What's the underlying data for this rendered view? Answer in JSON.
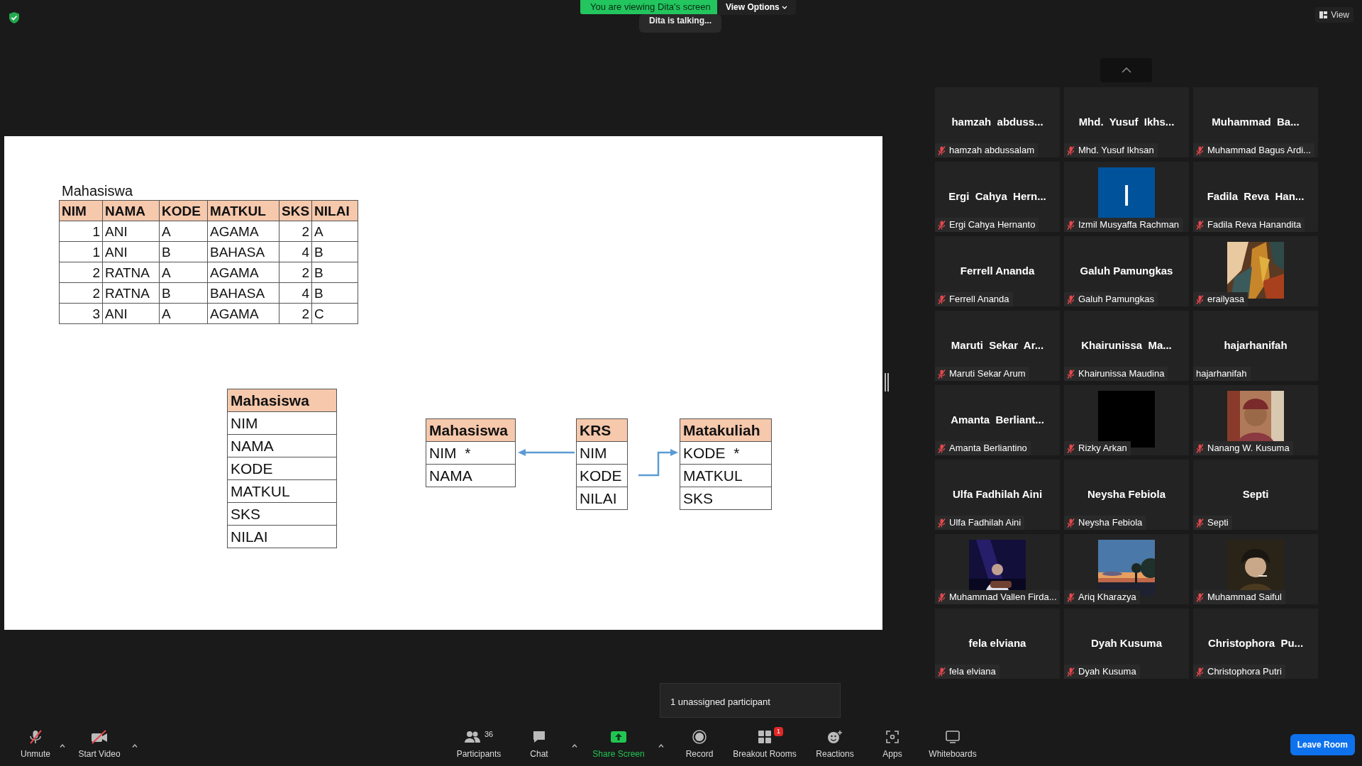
{
  "top_bar": {
    "banner": "You are viewing Dita's screen",
    "view_options": "View Options",
    "talking": "Dita is talking...",
    "view": "View"
  },
  "slide": {
    "caption": "Mahasiswa",
    "table": {
      "columns": [
        "NIM",
        "NAMA",
        "KODE",
        "MATKUL",
        "SKS",
        "NILAI"
      ],
      "rows": [
        [
          "1",
          "ANI",
          "A",
          "AGAMA",
          "2",
          "A"
        ],
        [
          "1",
          "ANI",
          "B",
          "BAHASA",
          "4",
          "B"
        ],
        [
          "2",
          "RATNA",
          "A",
          "AGAMA",
          "2",
          "B"
        ],
        [
          "2",
          "RATNA",
          "B",
          "BAHASA",
          "4",
          "B"
        ],
        [
          "3",
          "ANI",
          "A",
          "AGAMA",
          "2",
          "C"
        ]
      ]
    },
    "entities": [
      {
        "title": "Mahasiswa",
        "fields": [
          "NIM",
          "NAMA",
          "KODE",
          "MATKUL",
          "SKS",
          "NILAI"
        ]
      },
      {
        "title": "Mahasiswa",
        "fields": [
          "NIM  *",
          "NAMA"
        ]
      },
      {
        "title": "KRS",
        "fields": [
          "NIM",
          "KODE",
          "NILAI"
        ]
      },
      {
        "title": "Matakuliah",
        "fields": [
          "KODE  *",
          "MATKUL",
          "SKS"
        ]
      }
    ]
  },
  "gallery": {
    "tiles": [
      {
        "kind": "name",
        "display": "hamzah  abduss...",
        "label": "hamzah abdussalam",
        "muted": true
      },
      {
        "kind": "name",
        "display": "Mhd.  Yusuf  Ikhs...",
        "label": "Mhd. Yusuf Ikhsan",
        "muted": true
      },
      {
        "kind": "name",
        "display": "Muhammad  Ba...",
        "label": "Muhammad Bagus Ardi...",
        "muted": true
      },
      {
        "kind": "name",
        "display": "Ergi  Cahya  Hern...",
        "label": "Ergi Cahya Hernanto",
        "muted": true
      },
      {
        "kind": "letter",
        "display": "I",
        "label": "Izmil Musyaffa Rachman",
        "muted": true
      },
      {
        "kind": "name",
        "display": "Fadila  Reva  Han...",
        "label": "Fadila Reva Hanandita",
        "muted": true
      },
      {
        "kind": "name",
        "display": "Ferrell Ananda",
        "label": "Ferrell Ananda",
        "muted": true
      },
      {
        "kind": "name",
        "display": "Galuh Pamungkas",
        "label": "Galuh Pamungkas",
        "muted": true
      },
      {
        "kind": "picture",
        "label": "erailyasa",
        "muted": true
      },
      {
        "kind": "name",
        "display": "Maruti  Sekar  Ar...",
        "label": "Maruti Sekar Arum",
        "muted": true
      },
      {
        "kind": "name",
        "display": "Khairunissa  Ma...",
        "label": "Khairunissa Maudina",
        "muted": true
      },
      {
        "kind": "name",
        "display": "hajarhanifah",
        "label": "hajarhanifah",
        "muted": false
      },
      {
        "kind": "name",
        "display": "Amanta  Berliant...",
        "label": "Amanta Berliantino",
        "muted": true
      },
      {
        "kind": "blank",
        "label": "Rizky Arkan",
        "muted": true
      },
      {
        "kind": "picture",
        "label": "Nanang W. Kusuma",
        "muted": true
      },
      {
        "kind": "name",
        "display": "Ulfa Fadhilah Aini",
        "label": "Ulfa Fadhilah Aini",
        "muted": true
      },
      {
        "kind": "name",
        "display": "Neysha Febiola",
        "label": "Neysha Febiola",
        "muted": true
      },
      {
        "kind": "name",
        "display": "Septi",
        "label": "Septi",
        "muted": true
      },
      {
        "kind": "picture",
        "label": "Muhammad Vallen Firda...",
        "muted": true
      },
      {
        "kind": "picture",
        "label": "Ariq Kharazya",
        "muted": true
      },
      {
        "kind": "picture",
        "label": "Muhammad Saiful",
        "muted": true
      },
      {
        "kind": "name",
        "display": "fela elviana",
        "label": "fela elviana",
        "muted": true
      },
      {
        "kind": "name",
        "display": "Dyah Kusuma",
        "label": "Dyah Kusuma",
        "muted": true
      },
      {
        "kind": "name",
        "display": "Christophora  Pu...",
        "label": "Christophora Putri",
        "muted": true
      }
    ]
  },
  "popup": "1 unassigned participant",
  "toolbar": {
    "left": [
      {
        "kind": "mic",
        "label": "Unmute",
        "caret": true
      },
      {
        "kind": "video",
        "label": "Start Video",
        "caret": true
      }
    ],
    "center": [
      {
        "kind": "participants",
        "label": "Participants",
        "count": "36",
        "caret": false
      },
      {
        "kind": "chat",
        "label": "Chat",
        "caret": true
      },
      {
        "kind": "share",
        "label": "Share Screen",
        "caret": true
      },
      {
        "kind": "record",
        "label": "Record",
        "caret": false
      },
      {
        "kind": "breakout",
        "label": "Breakout Rooms",
        "badge": "1",
        "caret": false
      },
      {
        "kind": "reactions",
        "label": "Reactions",
        "caret": false
      },
      {
        "kind": "apps",
        "label": "Apps",
        "caret": false
      },
      {
        "kind": "whiteboards",
        "label": "Whiteboards",
        "caret": false
      }
    ],
    "leave": "Leave Room"
  }
}
